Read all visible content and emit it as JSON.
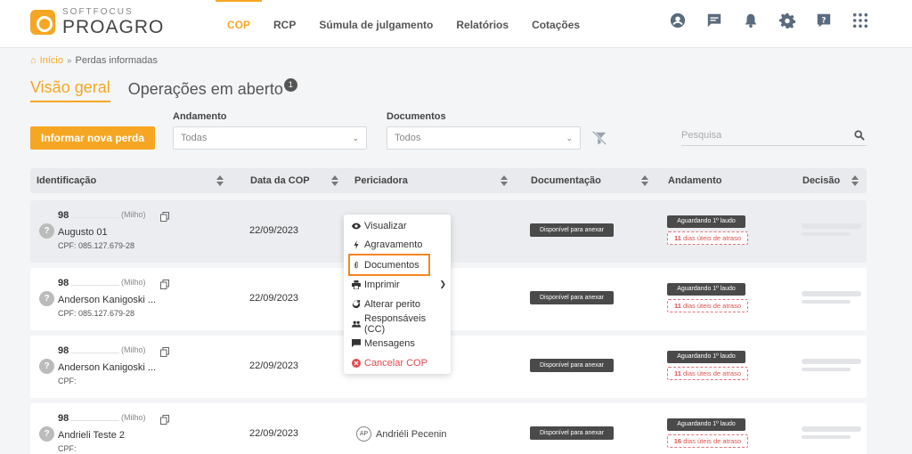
{
  "brand": {
    "sub": "SOFTFOCUS",
    "main": "PROAGRO"
  },
  "nav": [
    {
      "label": "COP",
      "active": true
    },
    {
      "label": "RCP"
    },
    {
      "label": "Súmula de julgamento"
    },
    {
      "label": "Relatórios"
    },
    {
      "label": "Cotações"
    }
  ],
  "header_icons": [
    "user-circle-icon",
    "chat-icon",
    "bell-icon",
    "gear-icon",
    "help-icon",
    "apps-grid-icon"
  ],
  "breadcrumb": {
    "home": "Início",
    "sep": "»",
    "current": "Perdas informadas"
  },
  "tabs": {
    "overview": "Visão geral",
    "open": "Operações em aberto",
    "open_badge": "1"
  },
  "actions": {
    "new_loss": "Informar nova perda"
  },
  "filters": {
    "andamento_label": "Andamento",
    "andamento_value": "Todas",
    "documentos_label": "Documentos",
    "documentos_value": "Todos",
    "search_placeholder": "Pesquisa"
  },
  "columns": {
    "identificacao": "Identificação",
    "data": "Data da COP",
    "periciadora": "Periciadora",
    "documentacao": "Documentação",
    "andamento": "Andamento",
    "decisao": "Decisão"
  },
  "rows": [
    {
      "id": "98",
      "crop": "(Milho)",
      "name": "Augusto 01",
      "cpf": "CPF: 085.127.679-28",
      "date": "22/09/2023",
      "doc": "Disponível para anexar",
      "status": "Aguardando 1º laudo",
      "late_num": "11",
      "late_text": "dias úteis de atraso",
      "perito": ""
    },
    {
      "id": "98",
      "crop": "(Milho)",
      "name": "Anderson Kanigoski ...",
      "cpf": "CPF: 085.127.679-28",
      "date": "22/09/2023",
      "doc": "Disponível para anexar",
      "status": "Aguardando 1º laudo",
      "late_num": "11",
      "late_text": "dias úteis de atraso",
      "perito": ""
    },
    {
      "id": "98",
      "crop": "(Milho)",
      "name": "Anderson Kanigoski ...",
      "cpf": "CPF:",
      "date": "22/09/2023",
      "doc": "Disponível para anexar",
      "status": "Aguardando 1º laudo",
      "late_num": "11",
      "late_text": "dias úteis de atraso",
      "perito": ""
    },
    {
      "id": "98",
      "crop": "(Milho)",
      "name": "Andrieli Teste 2",
      "cpf": "CPF:",
      "date": "22/09/2023",
      "doc": "Disponível para anexar",
      "status": "Aguardando 1º laudo",
      "late_num": "16",
      "late_text": "dias úteis de atraso",
      "perito_initials": "AP",
      "perito": "Andriéli Pecenin"
    }
  ],
  "menu": {
    "visualizar": "Visualizar",
    "agravamento": "Agravamento",
    "documentos": "Documentos",
    "imprimir": "Imprimir",
    "alterar_perito": "Alterar perito",
    "responsaveis": "Responsáveis (CC)",
    "mensagens": "Mensagens",
    "cancelar": "Cancelar COP"
  },
  "colors": {
    "accent": "#f5a623",
    "danger": "#e5484d",
    "focus": "#f5861f"
  }
}
